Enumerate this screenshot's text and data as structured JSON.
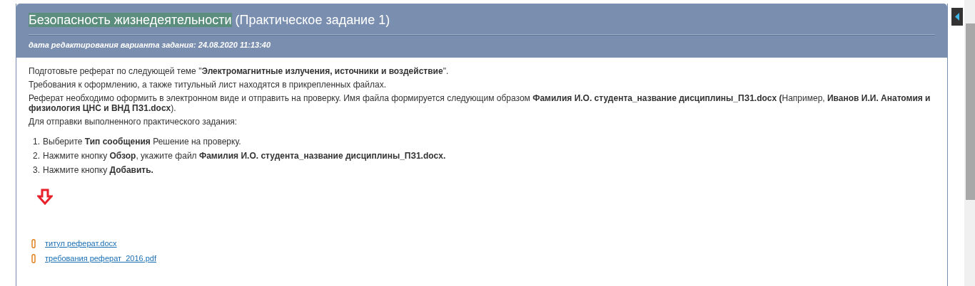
{
  "header": {
    "title_highlight": "Безопасность жизнедеятельности",
    "title_rest": "(Практическое задание 1)",
    "edit_date": "дата редактирования варианта задания: 24.08.2020 11:13:40"
  },
  "paragraphs": [
    "Подготовьте реферат по следующей теме \"**Электромагнитные излучения, источники и воздействие**\".",
    "Требования к оформлению, а также титульный лист находятся в прикрепленных файлах.",
    "Реферат необходимо оформить в электронном виде и отправить на проверку. Имя файла формируется следующим образом **Фамилия И.О. студента_название дисциплины_ПЗ1.docx (**Например, **Иванов И.И. Анатомия и физиология ЦНС и ВНД ПЗ1.docx**).",
    "Для отправки выполненного практического задания:"
  ],
  "steps": [
    {
      "number": "1.",
      "text": "Выберите **Тип сообщения** Решение на проверку."
    },
    {
      "number": "2.",
      "text": "Нажмите кнопку **Обзор**, укажите файл **Фамилия И.О. студента_название дисциплины_ПЗ1.docx.**"
    },
    {
      "number": "3.",
      "text": "Нажмите кнопку **Добавить.**"
    }
  ],
  "attachments": [
    {
      "name": "титул реферат.docx"
    },
    {
      "name": "требования реферат  2016.pdf"
    }
  ]
}
